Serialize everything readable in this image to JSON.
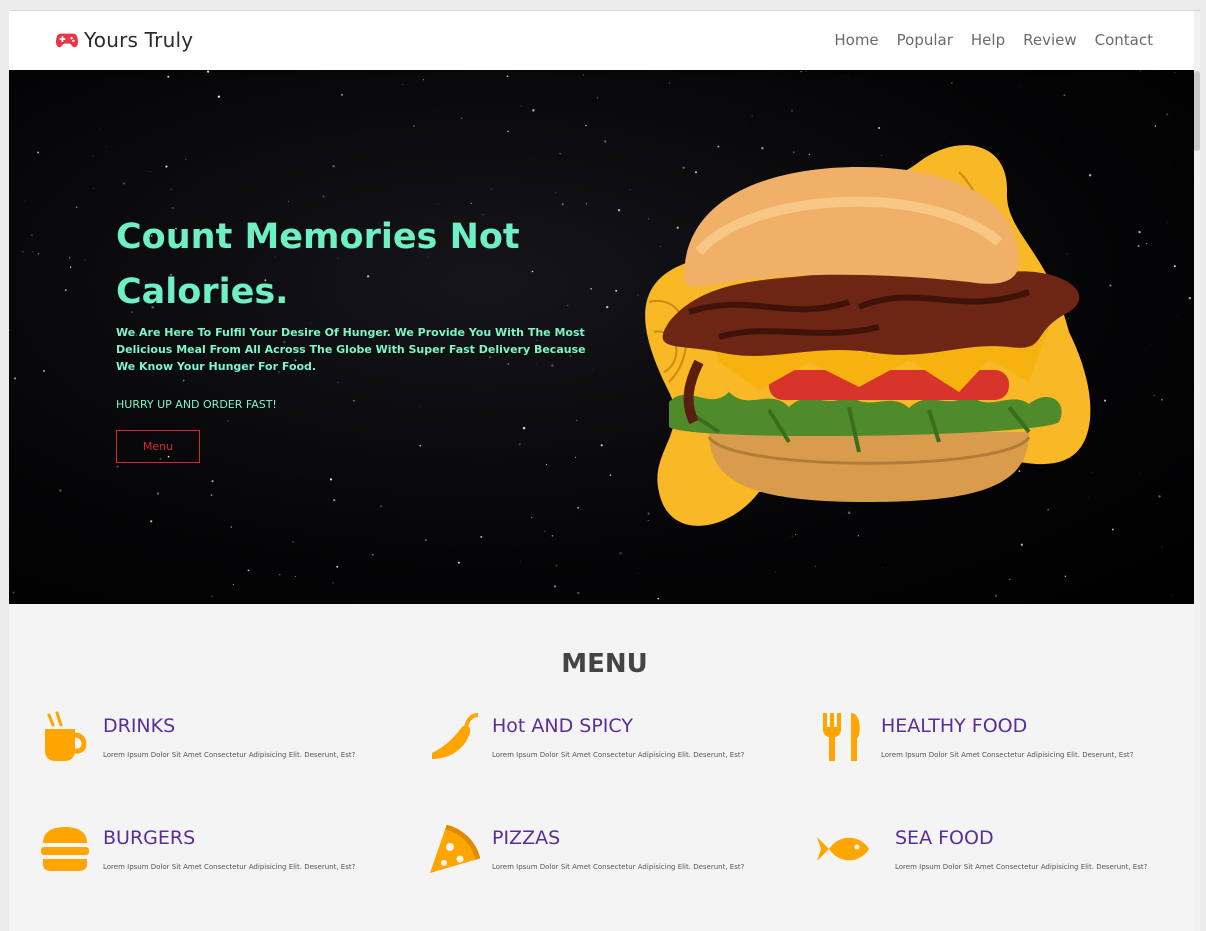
{
  "navbar": {
    "brand": "Yours Truly",
    "brand_icon": "gamepad-icon",
    "links": [
      "Home",
      "Popular",
      "Help",
      "Review",
      "Contact"
    ]
  },
  "hero": {
    "title": "Count Memories Not Calories.",
    "description": "We Are Here To Fulfil Your Desire Of Hunger. We Provide You With The Most Delicious Meal From All Across The Globe With Super Fast Delivery Because We Know Your Hunger For Food.",
    "cta_text": "HURRY UP AND ORDER FAST!",
    "button_label": "Menu",
    "image": "burger-image"
  },
  "menu": {
    "heading": "MENU",
    "items": [
      {
        "title": "DRINKS",
        "icon": "coffee-cup-icon",
        "description": "Lorem Ipsum Dolor Sit Amet Consectetur Adipisicing Elit. Deserunt, Est?"
      },
      {
        "title": "Hot AND SPICY",
        "icon": "chili-pepper-icon",
        "description": "Lorem Ipsum Dolor Sit Amet Consectetur Adipisicing Elit. Deserunt, Est?"
      },
      {
        "title": "HEALTHY FOOD",
        "icon": "utensils-icon",
        "description": "Lorem Ipsum Dolor Sit Amet Consectetur Adipisicing Elit. Deserunt, Est?"
      },
      {
        "title": "BURGERS",
        "icon": "hamburger-icon",
        "description": "Lorem Ipsum Dolor Sit Amet Consectetur Adipisicing Elit. Deserunt, Est?"
      },
      {
        "title": "PIZZAS",
        "icon": "pizza-slice-icon",
        "description": "Lorem Ipsum Dolor Sit Amet Consectetur Adipisicing Elit. Deserunt, Est?"
      },
      {
        "title": "SEA FOOD",
        "icon": "fish-icon",
        "description": "Lorem Ipsum Dolor Sit Amet Consectetur Adipisicing Elit. Deserunt, Est?"
      }
    ]
  },
  "colors": {
    "hero_text": "#6ff0c4",
    "menu_title": "#5b2e97",
    "icon_orange": "#ffa500",
    "button_red": "#d12a2a",
    "blob_yellow": "#f9b826"
  }
}
